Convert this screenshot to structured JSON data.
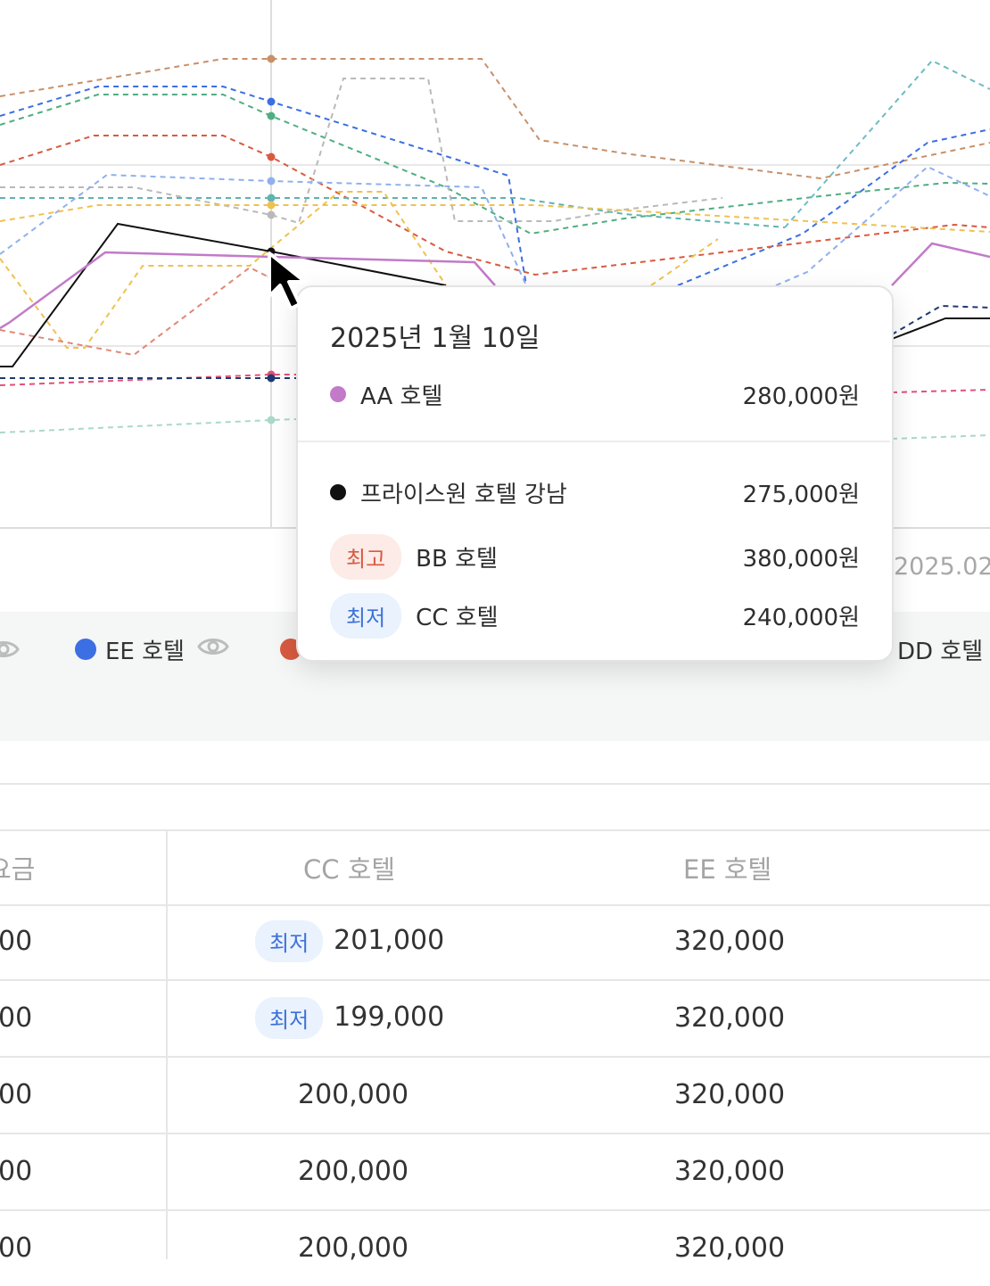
{
  "colors": {
    "aa": "#c27ac9",
    "priceone": "#111111",
    "ee": "#3b6fe3",
    "red": "#d85a40",
    "badge_low_bg": "#eaf2fd",
    "badge_low_text": "#3d72d8",
    "badge_high_bg": "#fcebe7",
    "badge_high_text": "#d85a40"
  },
  "chart": {
    "x_axis_partial_label": "2025.02",
    "hover_guide": "vertical-line"
  },
  "tooltip": {
    "date": "2025년 1월 10일",
    "primary": {
      "name": "AA 호텔",
      "price": "280,000원"
    },
    "rows": [
      {
        "badge": "",
        "name": "프라이스원 호텔 강남",
        "price": "275,000원"
      },
      {
        "badge": "최고",
        "name": "BB 호텔",
        "price": "380,000원"
      },
      {
        "badge": "최저",
        "name": "CC 호텔",
        "price": "240,000원"
      }
    ]
  },
  "legend": {
    "items": [
      {
        "label": "EE 호텔",
        "icon": "eye-icon"
      },
      {
        "label": "DD 호텔",
        "icon": "eye-icon"
      }
    ]
  },
  "table": {
    "headers": {
      "first_partial": "요금",
      "cc": "CC 호텔",
      "ee": "EE 호텔"
    },
    "rows": [
      {
        "first": "00",
        "cc_badge": "최저",
        "cc": "201,000",
        "ee": "320,000"
      },
      {
        "first": "00",
        "cc_badge": "최저",
        "cc": "199,000",
        "ee": "320,000"
      },
      {
        "first": "00",
        "cc_badge": "",
        "cc": "200,000",
        "ee": "320,000"
      },
      {
        "first": "00",
        "cc_badge": "",
        "cc": "200,000",
        "ee": "320,000"
      },
      {
        "first": "00",
        "cc_badge": "",
        "cc": "200,000",
        "ee": "320,000"
      }
    ]
  }
}
